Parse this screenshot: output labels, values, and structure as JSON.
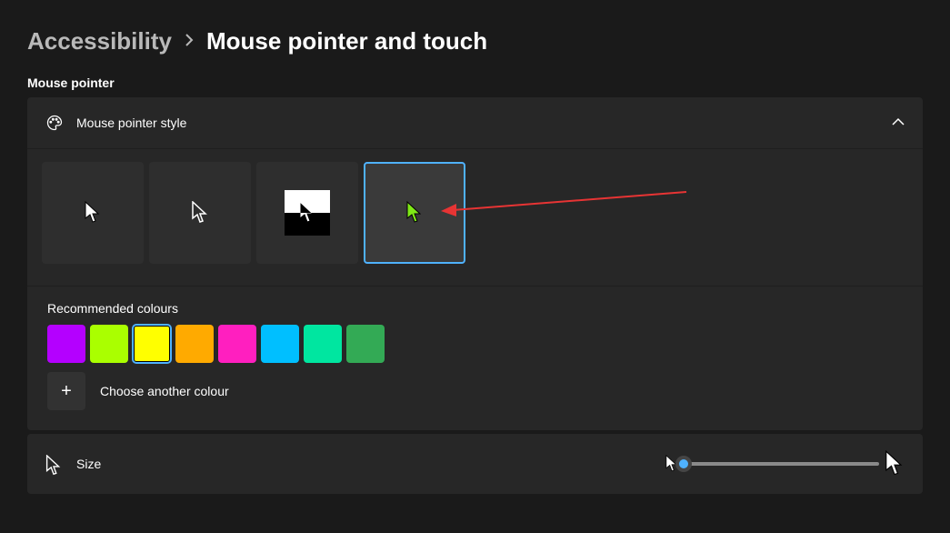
{
  "breadcrumb": {
    "parent": "Accessibility",
    "current": "Mouse pointer and touch"
  },
  "section_label": "Mouse pointer",
  "style_panel": {
    "title": "Mouse pointer style",
    "selected_index": 3,
    "custom_color": "#7fe817"
  },
  "colors": {
    "title": "Recommended colours",
    "selected_index": 2,
    "swatches": [
      "#b400ff",
      "#aaff00",
      "#ffff00",
      "#ffaa00",
      "#ff1fbf",
      "#00bfff",
      "#00e6a0",
      "#33aa55"
    ],
    "choose_label": "Choose another colour"
  },
  "size": {
    "label": "Size",
    "value_percent": 0
  }
}
